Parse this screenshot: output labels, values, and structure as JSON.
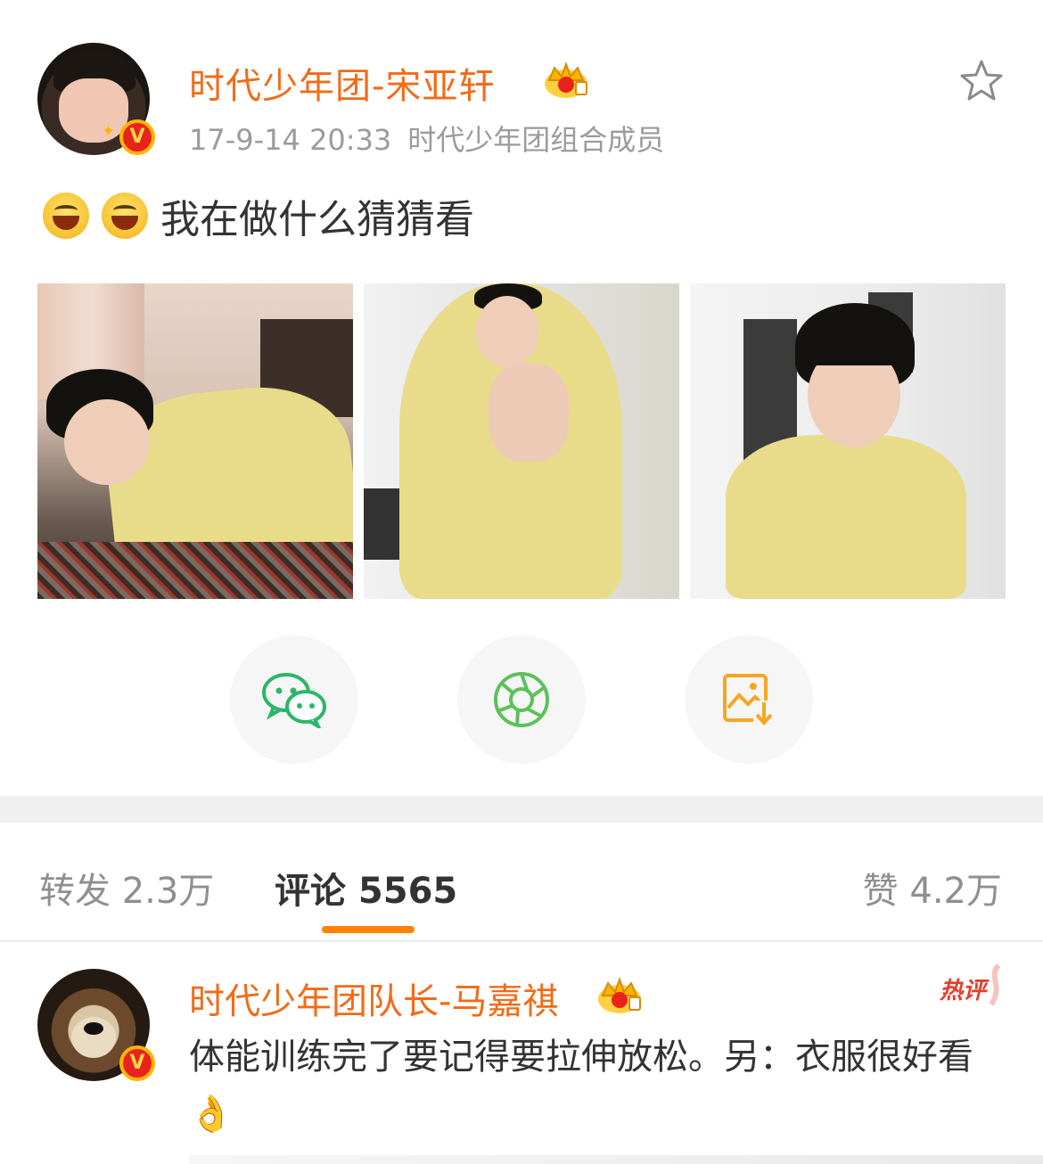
{
  "post": {
    "author": "时代少年团-宋亚轩",
    "timestamp": "17-9-14 20:33",
    "source": "时代少年团组合成员",
    "text": "我在做什么猜猜看",
    "emojis": [
      "grin-emoji",
      "grin-emoji"
    ],
    "photos": [
      {
        "name": "photo-1"
      },
      {
        "name": "photo-2"
      },
      {
        "name": "photo-3"
      }
    ]
  },
  "share": {
    "buttons": [
      {
        "icon": "wechat-icon",
        "color": "#2bb768"
      },
      {
        "icon": "moments-icon",
        "color": "#5cc15b"
      },
      {
        "icon": "save-image-icon",
        "color": "#f5a623"
      }
    ]
  },
  "tabs": {
    "repost": "转发 2.3万",
    "comments": "评论 5565",
    "likes": "赞 4.2万"
  },
  "comment": {
    "author": "时代少年团队长-马嘉祺",
    "badge": "热评",
    "text": "体能训练完了要记得要拉伸放松。另：衣服很好看"
  },
  "colors": {
    "username": "#f26b17",
    "accent": "#ff8200",
    "meta": "#9b9b9b"
  }
}
